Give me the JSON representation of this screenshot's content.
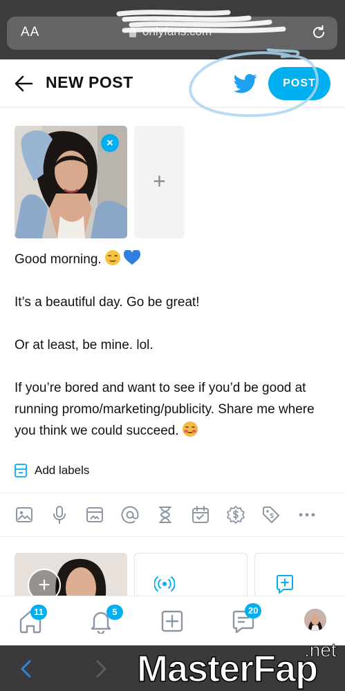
{
  "browser": {
    "text_size_label": "AA",
    "url": "onlyfans.com",
    "watermark_text": "MasterFap",
    "watermark_suffix": ".net"
  },
  "header": {
    "title": "NEW POST",
    "post_button": "POST"
  },
  "media": {
    "add_symbol": "+"
  },
  "post": {
    "paragraphs": [
      "Good morning.",
      "It’s a beautiful day. Go be great!",
      "Or at least, be mine. lol.",
      "If you’re bored and want to see if you’d be good at running promo/marketing/publicity. Share me where you think we could succeed."
    ]
  },
  "labels": {
    "add_labels": "Add labels"
  },
  "toolbar": {
    "icons": [
      "image-icon",
      "microphone-icon",
      "vault-icon",
      "mention-icon",
      "hourglass-icon",
      "calendar-icon",
      "price-icon",
      "tag-icon",
      "more-icon"
    ]
  },
  "bottom_nav": {
    "home_badge": "11",
    "notifications_badge": "5",
    "messages_badge": "20"
  },
  "colors": {
    "accent": "#00aff0",
    "browser_chrome": "#3d3d3f"
  }
}
